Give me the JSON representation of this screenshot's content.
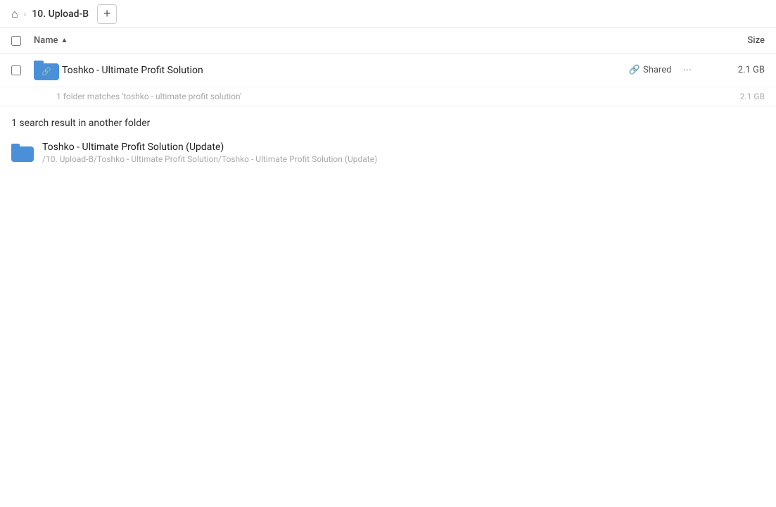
{
  "breadcrumb": {
    "home_title": "Home",
    "separator": "›",
    "current": "10. Upload-B"
  },
  "add_button_label": "+",
  "columns": {
    "name_label": "Name",
    "sort_indicator": "▲",
    "size_label": "Size"
  },
  "main_result": {
    "filename": "Toshko - Ultimate Profit Solution",
    "shared_label": "Shared",
    "more_icon": "···",
    "size": "2.1 GB",
    "match_text": "1 folder matches 'toshko - ultimate profit solution'",
    "match_size": "2.1 GB"
  },
  "section_header": "1 search result in another folder",
  "other_result": {
    "name": "Toshko - Ultimate Profit Solution (Update)",
    "path": "/10. Upload-B/Toshko - Ultimate Profit Solution/Toshko - Ultimate Profit Solution (Update)"
  }
}
